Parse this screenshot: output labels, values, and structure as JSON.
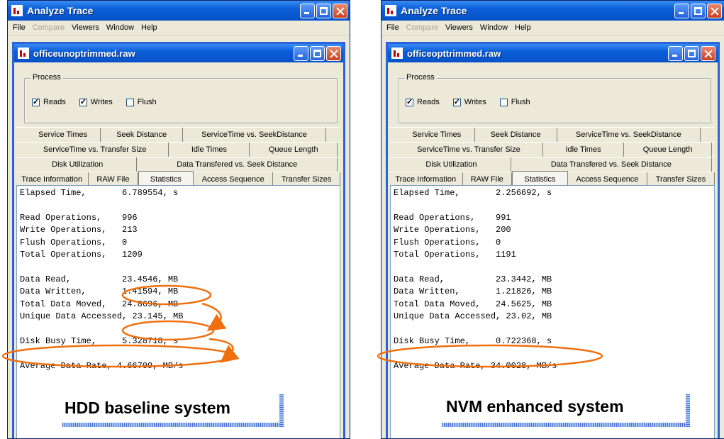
{
  "left": {
    "app_title": "Analyze Trace",
    "menu": [
      "File",
      "Compare",
      "Viewers",
      "Window",
      "Help"
    ],
    "child_title": "officeunoptrimmed.raw",
    "process": {
      "legend": "Process",
      "reads": "Reads",
      "writes": "Writes",
      "flush": "Flush"
    },
    "tabs_row1": [
      "Service Times",
      "Seek Distance",
      "ServiceTime vs. SeekDistance"
    ],
    "tabs_row2": [
      "ServiceTime  vs. Transfer Size",
      "Idle Times",
      "Queue Length"
    ],
    "tabs_row3": [
      "Disk Utilization",
      "Data Transfered vs. Seek Distance"
    ],
    "tabs_row4": [
      "Trace Information",
      "RAW File",
      "Statistics",
      "Access Sequence",
      "Transfer Sizes"
    ],
    "stats": {
      "elapsed": "Elapsed Time,       6.789554, s",
      "read_ops": "Read Operations,    996",
      "write_ops": "Write Operations,   213",
      "flush_ops": "Flush Operations,   0",
      "total_ops": "Total Operations,   1209",
      "data_read": "Data Read,          23.4546, MB",
      "data_written": "Data Written,       1.41594, MB",
      "total_moved": "Total Data Moved,   24.8696, MB",
      "unique": "Unique Data Accessed, 23.145, MB",
      "busy": "Disk Busy Time,     5.328718, s",
      "rate": "Average Data Rate, 4.66709, MB/s"
    },
    "caption": "HDD baseline system"
  },
  "right": {
    "app_title": "Analyze Trace",
    "menu": [
      "File",
      "Compare",
      "Viewers",
      "Window",
      "Help"
    ],
    "child_title": "officeopttrimmed.raw",
    "process": {
      "legend": "Process",
      "reads": "Reads",
      "writes": "Writes",
      "flush": "Flush"
    },
    "tabs_row1": [
      "Service Times",
      "Seek Distance",
      "ServiceTime vs. SeekDistance"
    ],
    "tabs_row2": [
      "ServiceTime  vs. Transfer Size",
      "Idle Times",
      "Queue Length"
    ],
    "tabs_row3": [
      "Disk Utilization",
      "Data Transfered vs. Seek Distance"
    ],
    "tabs_row4": [
      "Trace Information",
      "RAW File",
      "Statistics",
      "Access Sequence",
      "Transfer Sizes"
    ],
    "stats": {
      "elapsed": "Elapsed Time,       2.256692, s",
      "read_ops": "Read Operations,    991",
      "write_ops": "Write Operations,   200",
      "flush_ops": "Flush Operations,   0",
      "total_ops": "Total Operations,   1191",
      "data_read": "Data Read,          23.3442, MB",
      "data_written": "Data Written,       1.21826, MB",
      "total_moved": "Total Data Moved,   24.5625, MB",
      "unique": "Unique Data Accessed, 23.02, MB",
      "busy": "Disk Busy Time,     0.722368, s",
      "rate": "Average Data Rate, 34.0028, MB/s"
    },
    "caption": "NVM enhanced  system"
  },
  "colors": {
    "annotation": "#f07010",
    "titlebar": "#0a5fd8",
    "accent": "#3f6fd8"
  }
}
